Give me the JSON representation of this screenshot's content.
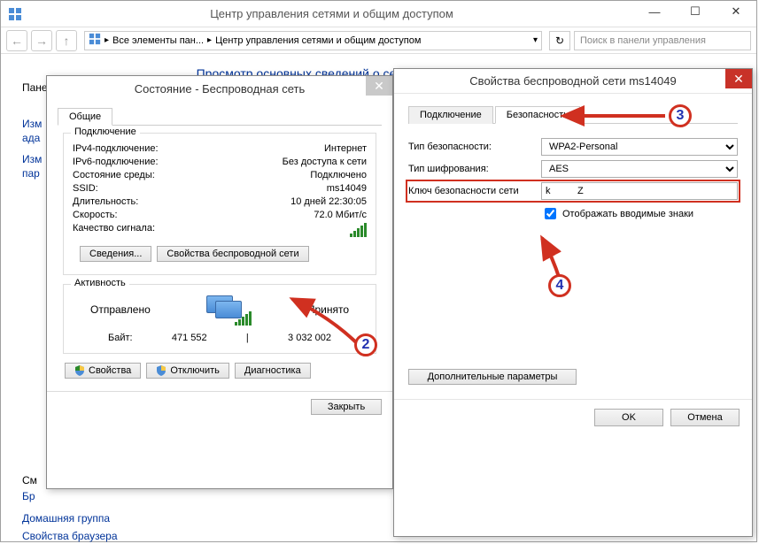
{
  "mainWindow": {
    "title": "Центр управления сетями и общим доступом",
    "breadcrumb": {
      "part1": "Все элементы пан...",
      "part2": "Центр управления сетями и общим доступом"
    },
    "searchPlaceholder": "Поиск в панели управления",
    "pageHeading": "Просмотр основных сведений о сети и настройка подключений",
    "partialLabels": {
      "l1": "Пане",
      "l2": "Изм",
      "l3": "ада",
      "l4": "Изм",
      "l5": "пар",
      "l6": "См",
      "l7": "Бр"
    },
    "links": {
      "home": "Домашняя группа",
      "browser": "Свойства браузера"
    }
  },
  "statusDialog": {
    "title": "Состояние - Беспроводная сеть",
    "tab": "Общие",
    "groupConnection": {
      "title": "Подключение",
      "rows": [
        {
          "lab": "IPv4-подключение:",
          "val": "Интернет"
        },
        {
          "lab": "IPv6-подключение:",
          "val": "Без доступа к сети"
        },
        {
          "lab": "Состояние среды:",
          "val": "Подключено"
        },
        {
          "lab": "SSID:",
          "val": "ms14049"
        },
        {
          "lab": "Длительность:",
          "val": "10 дней 22:30:05"
        },
        {
          "lab": "Скорость:",
          "val": "72.0 Мбит/с"
        }
      ],
      "signalLabel": "Качество сигнала:",
      "btnDetails": "Сведения...",
      "btnWifiProps": "Свойства беспроводной сети"
    },
    "groupActivity": {
      "title": "Активность",
      "sent": "Отправлено",
      "recv": "Принято",
      "bytesLabel": "Байт:",
      "sentVal": "471 552",
      "recvVal": "3 032 002"
    },
    "btnProps": "Свойства",
    "btnDisconnect": "Отключить",
    "btnDiag": "Диагностика",
    "btnClose": "Закрыть"
  },
  "propsDialog": {
    "title": "Свойства беспроводной сети ms14049",
    "tabConn": "Подключение",
    "tabSec": "Безопасность",
    "secType": {
      "label": "Тип безопасности:",
      "val": "WPA2-Personal"
    },
    "encType": {
      "label": "Тип шифрования:",
      "val": "AES"
    },
    "key": {
      "label": "Ключ безопасности сети",
      "val": "k          Z"
    },
    "showChars": "Отображать вводимые знаки",
    "btnAdv": "Дополнительные параметры",
    "btnOk": "OK",
    "btnCancel": "Отмена"
  },
  "annotations": {
    "n2": "2",
    "n3": "3",
    "n4": "4"
  }
}
